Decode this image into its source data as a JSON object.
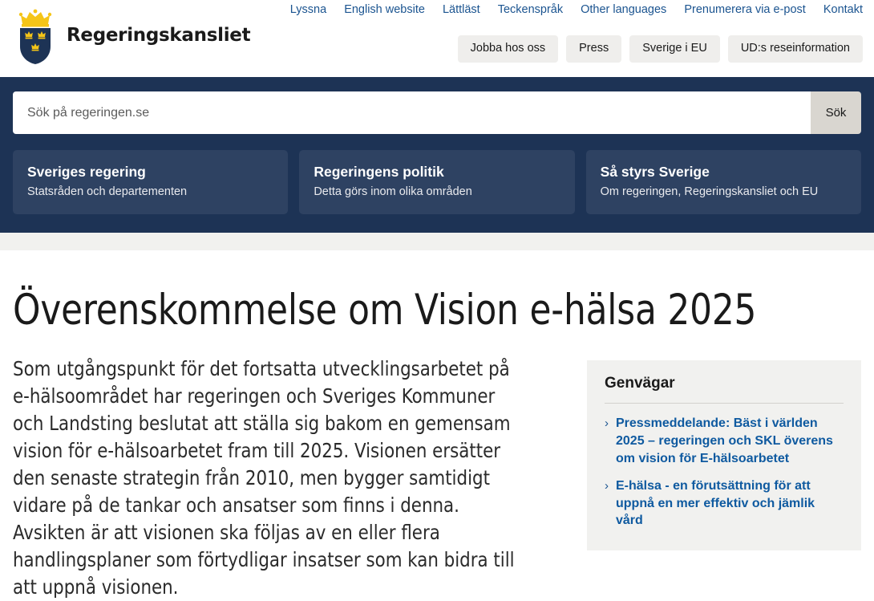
{
  "site": {
    "brand_name": "Regeringskansliet",
    "crest_icon": "swedish-three-crowns-coat-of-arms-icon",
    "colors": {
      "banner_navy": "#1d3355",
      "card_blue": "#2e4262",
      "link_blue": "#1b5490",
      "shortcut_blue": "#0f5aa0",
      "pill_grey": "#efeeec",
      "search_button": "#d9d6d0",
      "strip_grey": "#f1f1ef",
      "crest_gold": "#f5c518"
    }
  },
  "utility_nav": [
    {
      "label": "Lyssna"
    },
    {
      "label": "English website"
    },
    {
      "label": "Lättläst"
    },
    {
      "label": "Teckenspråk"
    },
    {
      "label": "Other languages"
    },
    {
      "label": "Prenumerera via e-post"
    },
    {
      "label": "Kontakt"
    }
  ],
  "pill_nav": [
    {
      "label": "Jobba hos oss"
    },
    {
      "label": "Press"
    },
    {
      "label": "Sverige i EU"
    },
    {
      "label": "UD:s reseinformation"
    }
  ],
  "search": {
    "placeholder": "Sök på regeringen.se",
    "value": "",
    "button_label": "Sök"
  },
  "cards": [
    {
      "title": "Sveriges regering",
      "subtitle": "Statsråden och departementen"
    },
    {
      "title": "Regeringens politik",
      "subtitle": "Detta görs inom olika områden"
    },
    {
      "title": "Så styrs Sverige",
      "subtitle": "Om regeringen, Regeringskansliet och EU"
    }
  ],
  "article": {
    "title": "Överenskommelse om Vision e-hälsa 2025",
    "lead": "Som utgångspunkt för det fortsatta utvecklingsarbetet på e-hälsoområdet har regeringen och Sveriges Kommuner och Landsting beslutat att ställa sig bakom en gemensam vision för e-hälsoarbetet fram till 2025. Visionen ersätter den senaste strategin från 2010, men bygger samtidigt vidare på de tankar och ansatser som finns i denna. Avsikten är att visionen ska följas av en eller flera handlingsplaner som förtydligar insatser som kan bidra till att uppnå visionen."
  },
  "shortcuts": {
    "title": "Genvägar",
    "chevron_glyph": "›",
    "items": [
      {
        "label": "Pressmeddelande: Bäst i världen 2025 – regeringen och SKL överens om vision för E-hälsoarbetet"
      },
      {
        "label": "E-hälsa - en förutsättning för att uppnå en mer effektiv och jämlik vård"
      }
    ]
  }
}
